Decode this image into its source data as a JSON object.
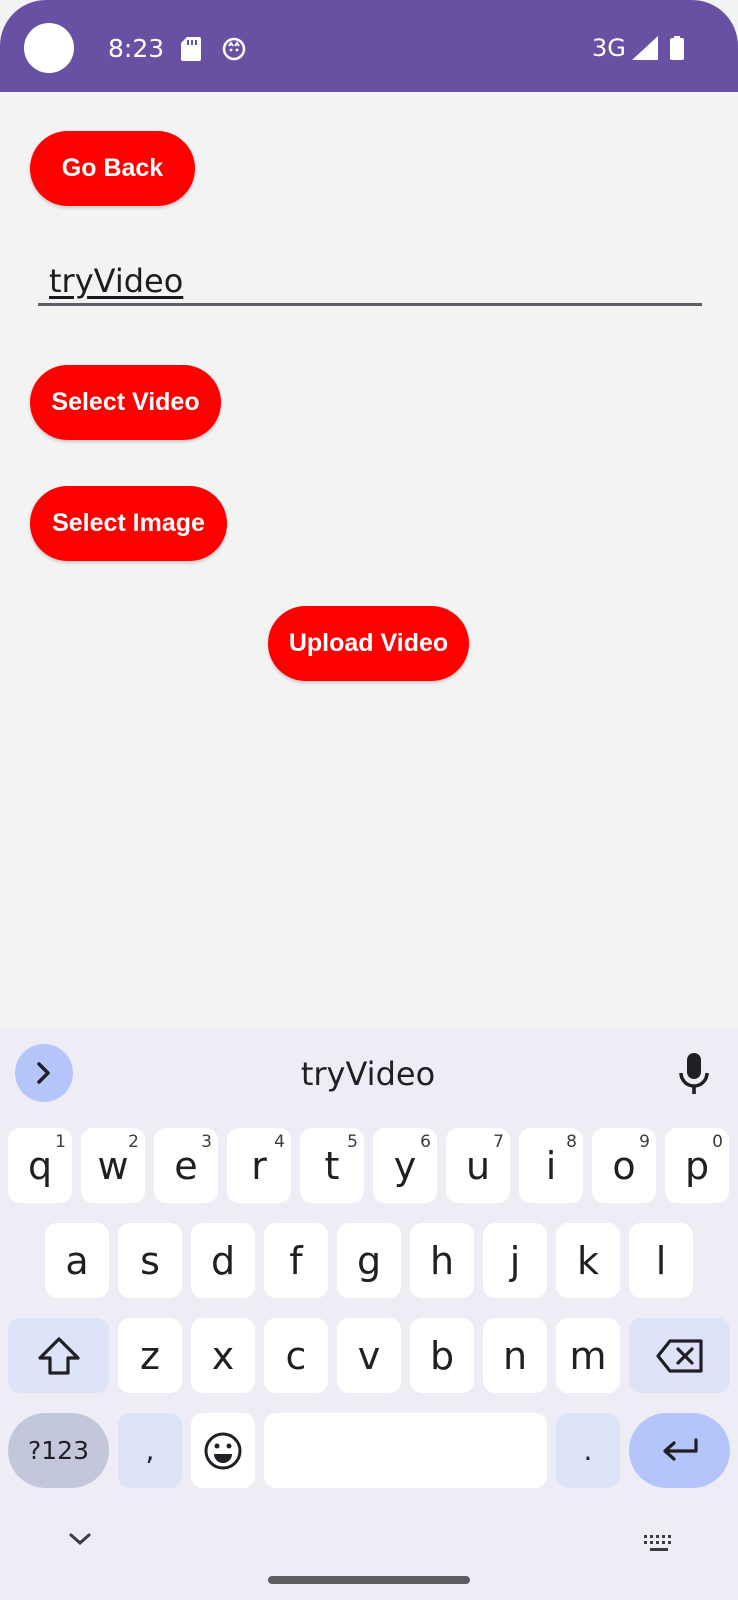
{
  "status_bar": {
    "time": "8:23",
    "network": "3G",
    "icons": [
      "sd-card-icon",
      "cat-notification-icon",
      "cell-signal-icon",
      "battery-icon"
    ],
    "background": "#6851a3"
  },
  "screen": {
    "go_back_label": "Go Back",
    "title_input_value": "tryVideo",
    "select_video_label": "Select Video",
    "select_image_label": "Select Image",
    "upload_video_label": "Upload Video",
    "button_color": "#ff0000"
  },
  "keyboard": {
    "suggestion": "tryVideo",
    "row1": [
      {
        "k": "q",
        "n": "1"
      },
      {
        "k": "w",
        "n": "2"
      },
      {
        "k": "e",
        "n": "3"
      },
      {
        "k": "r",
        "n": "4"
      },
      {
        "k": "t",
        "n": "5"
      },
      {
        "k": "y",
        "n": "6"
      },
      {
        "k": "u",
        "n": "7"
      },
      {
        "k": "i",
        "n": "8"
      },
      {
        "k": "o",
        "n": "9"
      },
      {
        "k": "p",
        "n": "0"
      }
    ],
    "row2": [
      "a",
      "s",
      "d",
      "f",
      "g",
      "h",
      "j",
      "k",
      "l"
    ],
    "row3": [
      "z",
      "x",
      "c",
      "v",
      "b",
      "n",
      "m"
    ],
    "symbols_label": "?123",
    "comma": ",",
    "period": "."
  }
}
